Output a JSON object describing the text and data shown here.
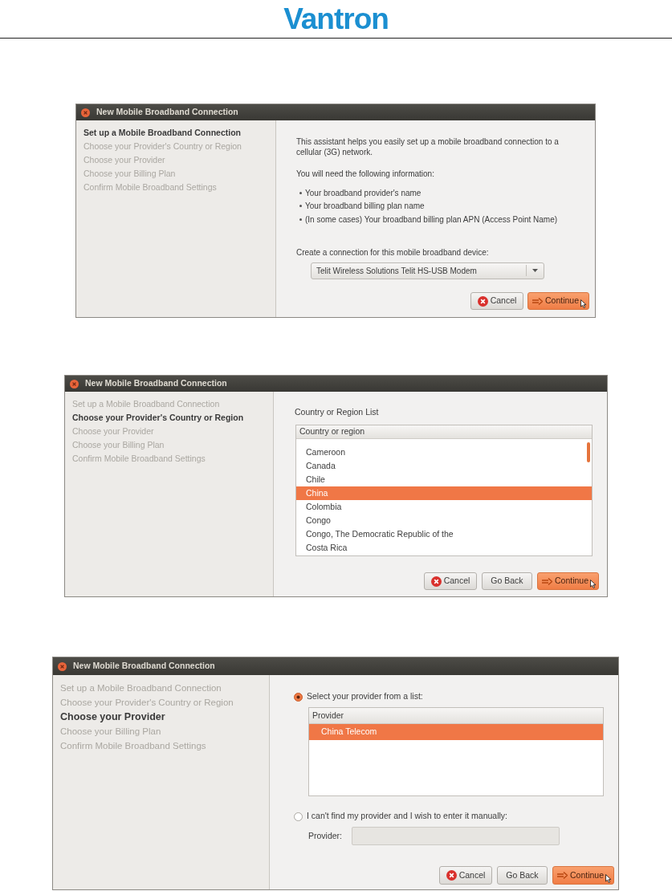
{
  "header": {
    "logo": "Vantron"
  },
  "dialogs": [
    {
      "title": "New Mobile Broadband Connection",
      "kind": "intro",
      "steps": [
        {
          "label": "Set up a Mobile Broadband Connection",
          "selected": true
        },
        {
          "label": "Choose your Provider's Country or Region",
          "selected": false
        },
        {
          "label": "Choose your Provider",
          "selected": false
        },
        {
          "label": "Choose your Billing Plan",
          "selected": false
        },
        {
          "label": "Confirm Mobile Broadband Settings",
          "selected": false
        }
      ],
      "intro": "This assistant helps you easily set up a mobile broadband connection to a cellular (3G) network.",
      "need": "You will need the following information:",
      "requirements": [
        "Your broadband provider's name",
        "Your broadband billing plan name",
        "(In some cases) Your broadband billing plan APN (Access Point Name)"
      ],
      "device_label": "Create a connection for this mobile broadband device:",
      "device_select": {
        "value": "Telit Wireless Solutions Telit HS-USB Modem"
      },
      "buttons": [
        {
          "label": "Cancel",
          "kind": "cancel"
        },
        {
          "label": "Continue",
          "kind": "continue"
        }
      ]
    },
    {
      "title": "New Mobile Broadband Connection",
      "kind": "country",
      "steps": [
        {
          "label": "Set up a Mobile Broadband Connection",
          "selected": false
        },
        {
          "label": "Choose your Provider's Country or Region",
          "selected": true
        },
        {
          "label": "Choose your Provider",
          "selected": false
        },
        {
          "label": "Choose your Billing Plan",
          "selected": false
        },
        {
          "label": "Confirm Mobile Broadband Settings",
          "selected": false
        }
      ],
      "list_label": "Country or Region List",
      "list": {
        "header": "Country or region",
        "rows": [
          {
            "label": "Cameroon",
            "selected": false
          },
          {
            "label": "Canada",
            "selected": false
          },
          {
            "label": "Chile",
            "selected": false
          },
          {
            "label": "China",
            "selected": true
          },
          {
            "label": "Colombia",
            "selected": false
          },
          {
            "label": "Congo",
            "selected": false
          },
          {
            "label": "Congo, The Democratic Republic of the",
            "selected": false
          },
          {
            "label": "Costa Rica",
            "selected": false
          }
        ]
      },
      "buttons": [
        {
          "label": "Cancel",
          "kind": "cancel"
        },
        {
          "label": "Go Back",
          "kind": "back"
        },
        {
          "label": "Continue",
          "kind": "continue"
        }
      ]
    },
    {
      "title": "New Mobile Broadband Connection",
      "kind": "provider",
      "steps": [
        {
          "label": "Set up a Mobile Broadband Connection",
          "selected": false
        },
        {
          "label": "Choose your Provider's Country or Region",
          "selected": false
        },
        {
          "label": "Choose your Provider",
          "selected": true
        },
        {
          "label": "Choose your Billing Plan",
          "selected": false
        },
        {
          "label": "Confirm Mobile Broadband Settings",
          "selected": false
        }
      ],
      "options": [
        {
          "label": "Select your provider from a list:",
          "selected": true
        },
        {
          "label": "I can't find my provider and I wish to enter it manually:",
          "selected": false
        }
      ],
      "list": {
        "header": "Provider",
        "rows": [
          {
            "label": "China Telecom",
            "selected": true
          }
        ]
      },
      "manual_field": {
        "label": "Provider:",
        "disabled": true
      },
      "buttons": [
        {
          "label": "Cancel",
          "kind": "cancel"
        },
        {
          "label": "Go Back",
          "kind": "back"
        },
        {
          "label": "Continue",
          "kind": "continue"
        }
      ]
    }
  ]
}
